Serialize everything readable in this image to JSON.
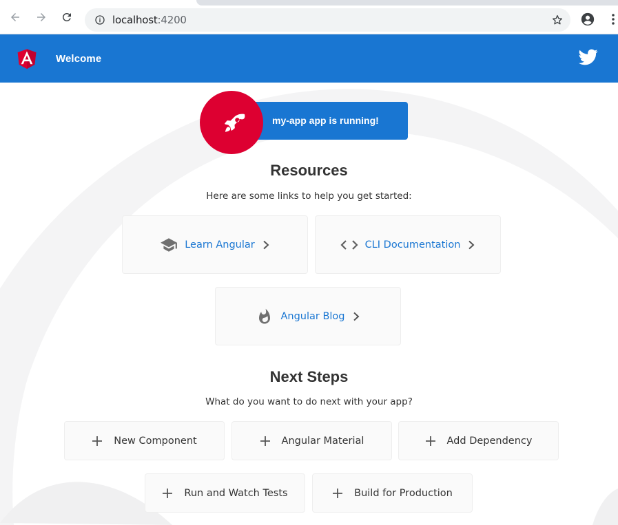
{
  "browser": {
    "url_host": "localhost",
    "url_port": ":4200"
  },
  "toolbar": {
    "title": "Welcome"
  },
  "running": {
    "text": "my-app app is running!"
  },
  "resources": {
    "heading": "Resources",
    "subheading": "Here are some links to help you get started:",
    "cards": [
      {
        "label": "Learn Angular",
        "icon": "graduation-cap-icon"
      },
      {
        "label": "CLI Documentation",
        "icon": "code-brackets-icon"
      },
      {
        "label": "Angular Blog",
        "icon": "flame-icon"
      }
    ]
  },
  "next_steps": {
    "heading": "Next Steps",
    "subheading": "What do you want to do next with your app?",
    "buttons": [
      {
        "label": "New Component"
      },
      {
        "label": "Angular Material"
      },
      {
        "label": "Add Dependency"
      },
      {
        "label": "Run and Watch Tests"
      },
      {
        "label": "Build for Production"
      }
    ]
  },
  "colors": {
    "primary": "#1976d2",
    "angular_red": "#dd0031",
    "card_bg": "#fafafa"
  }
}
